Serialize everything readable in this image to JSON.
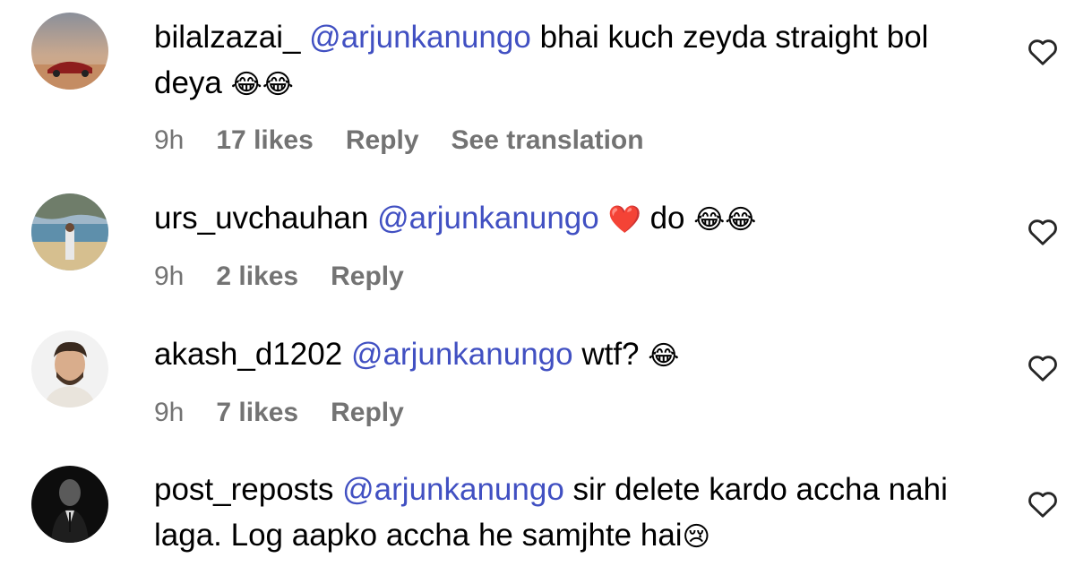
{
  "comments": [
    {
      "username": "bilalzazai_",
      "mention": "@arjunkanungo",
      "text": "bhai kuch zeyda straight bol deya",
      "emoji": "😂😂",
      "time": "9h",
      "likes": "17 likes",
      "reply": "Reply",
      "translation": "See translation"
    },
    {
      "username": "urs_uvchauhan",
      "mention": "@arjunkanungo",
      "heart_emoji": "❤️",
      "text": "do",
      "emoji": "😂😂",
      "time": "9h",
      "likes": "2 likes",
      "reply": "Reply"
    },
    {
      "username": "akash_d1202",
      "mention": "@arjunkanungo",
      "text": "wtf?",
      "emoji": "😂",
      "time": "9h",
      "likes": "7 likes",
      "reply": "Reply"
    },
    {
      "username": "post_reposts",
      "mention": "@arjunkanungo",
      "text": "sir delete kardo accha nahi laga. Log aapko accha he samjhte hai",
      "emoji": "😢"
    }
  ],
  "colors": {
    "mention": "#4150c2",
    "meta": "#737373"
  },
  "icons": {
    "like": "heart-outline-icon"
  }
}
